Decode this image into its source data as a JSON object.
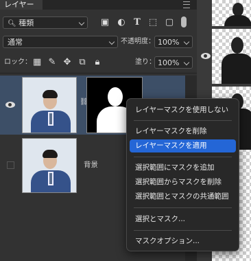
{
  "panel": {
    "tab_label": "レイヤー",
    "filter": {
      "value": "種類"
    },
    "blend_mode": "通常",
    "opacity_label": "不透明度：",
    "opacity_value": "100%",
    "lock_label": "ロック：",
    "fill_label": "塗り：",
    "fill_value": "100%"
  },
  "layers": [
    {
      "name": "",
      "has_mask": true,
      "visible": true,
      "selected": true
    },
    {
      "name": "背景",
      "has_mask": false,
      "visible": false,
      "selected": false
    }
  ],
  "context_menu": {
    "items": [
      {
        "label": "レイヤーマスクを使用しない"
      },
      {
        "label": "レイヤーマスクを削除"
      },
      {
        "label": "レイヤーマスクを適用",
        "highlighted": true
      },
      {
        "label": "選択範囲にマスクを追加"
      },
      {
        "label": "選択範囲からマスクを削除"
      },
      {
        "label": "選択範囲とマスクの共通範囲"
      },
      {
        "label": "選択とマスク..."
      },
      {
        "label": "マスクオプション..."
      }
    ]
  },
  "colors": {
    "accent": "#2466d6",
    "selected_layer": "#3d4f67"
  }
}
